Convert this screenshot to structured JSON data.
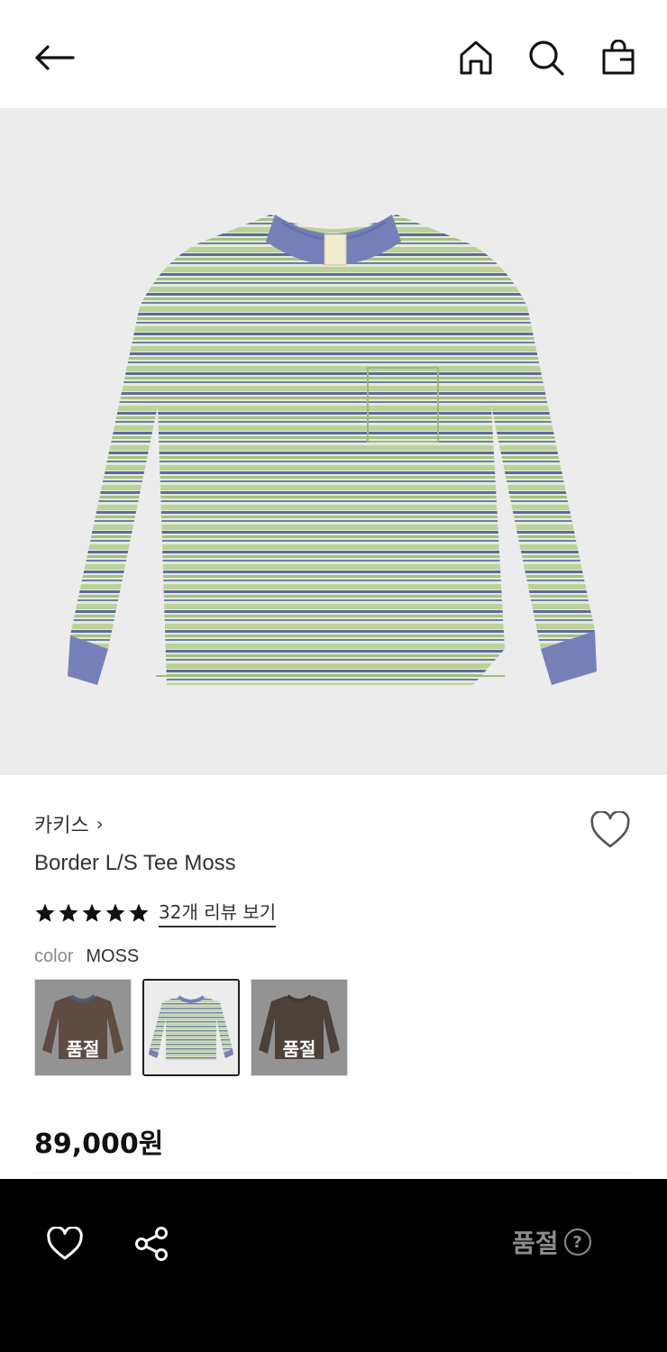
{
  "header": {
    "back_icon": "arrow-left-icon",
    "home_icon": "home-icon",
    "search_icon": "search-icon",
    "bag_icon": "shopping-bag-icon"
  },
  "product": {
    "image_icon": "striped-long-sleeve-tee-image",
    "brand": "카키스",
    "brand_chevron": "›",
    "name": "Border L/S Tee Moss",
    "rating_stars": 5,
    "review_link": "32개 리뷰 보기",
    "color_label": "color",
    "color_value": "MOSS",
    "swatches": [
      {
        "label": "품절",
        "color": "#8a6a5a",
        "sold_out": true
      },
      {
        "label": "",
        "color": "#c9d8b4",
        "sold_out": false
      },
      {
        "label": "품절",
        "color": "#6a5848",
        "sold_out": true
      }
    ],
    "price": "89,000원"
  },
  "bottom_bar": {
    "wish_icon": "heart-icon",
    "share_icon": "share-icon",
    "status": "품절",
    "help_glyph": "?"
  },
  "colors": {
    "stripe_green": "#c7d9a6",
    "stripe_blue": "#5a6a9a",
    "rib": "#7680b8",
    "hero_bg": "#ececec",
    "bottom_bar_bg": "#000000",
    "muted_text": "#8c8c8c"
  }
}
